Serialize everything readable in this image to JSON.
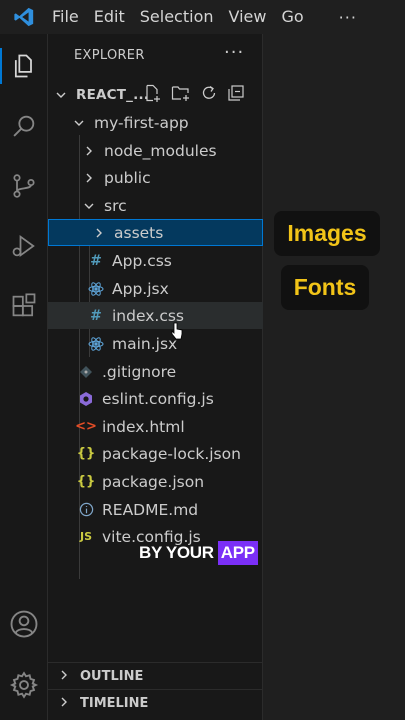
{
  "menu": {
    "items": [
      "File",
      "Edit",
      "Selection",
      "View",
      "Go"
    ],
    "more": "···"
  },
  "activity": [
    "explorer-icon",
    "search-icon",
    "source-control-icon",
    "run-debug-icon",
    "extensions-icon",
    "account-icon",
    "settings-gear-icon"
  ],
  "explorer": {
    "header": "EXPLORER",
    "more": "···",
    "project": "REACT_...",
    "tree": [
      {
        "label": "my-first-app",
        "type": "folder-open",
        "icon": "chevron-down-icon"
      },
      {
        "label": "node_modules",
        "type": "folder",
        "icon": "chevron-right-icon"
      },
      {
        "label": "public",
        "type": "folder",
        "icon": "chevron-right-icon"
      },
      {
        "label": "src",
        "type": "folder-open",
        "icon": "chevron-down-icon"
      },
      {
        "label": "assets",
        "type": "folder",
        "icon": "chevron-right-icon"
      },
      {
        "label": "App.css",
        "type": "css",
        "icon": "hash-icon"
      },
      {
        "label": "App.jsx",
        "type": "react",
        "icon": "react-icon"
      },
      {
        "label": "index.css",
        "type": "css",
        "icon": "hash-icon"
      },
      {
        "label": "main.jsx",
        "type": "react",
        "icon": "react-icon"
      },
      {
        "label": ".gitignore",
        "type": "git",
        "icon": "git-diamond-icon"
      },
      {
        "label": "eslint.config.js",
        "type": "eslint",
        "icon": "eslint-icon"
      },
      {
        "label": "index.html",
        "type": "html",
        "icon": "html-brackets-icon"
      },
      {
        "label": "package-lock.json",
        "type": "json",
        "icon": "json-braces-icon"
      },
      {
        "label": "package.json",
        "type": "json",
        "icon": "json-braces-icon"
      },
      {
        "label": "README.md",
        "type": "info",
        "icon": "info-icon"
      },
      {
        "label": "vite.config.js",
        "type": "js",
        "icon": "js-icon"
      }
    ],
    "sections": [
      "OUTLINE",
      "TIMELINE"
    ]
  },
  "overlay": {
    "images": "Images",
    "fonts": "Fonts",
    "caption_pre": "BY YOUR",
    "caption_hl": "APP"
  },
  "colors": {
    "accent": "#0078d4",
    "selected_bg": "#04395e",
    "css_blue": "#519aba",
    "react_blue": "#5ea4d8",
    "json_yellow": "#cbcb41",
    "html_orange": "#e44d26",
    "eslint_purple": "#8a6ad8",
    "highlight_yellow": "#f2c418",
    "caption_purple": "#7b2ff7"
  }
}
